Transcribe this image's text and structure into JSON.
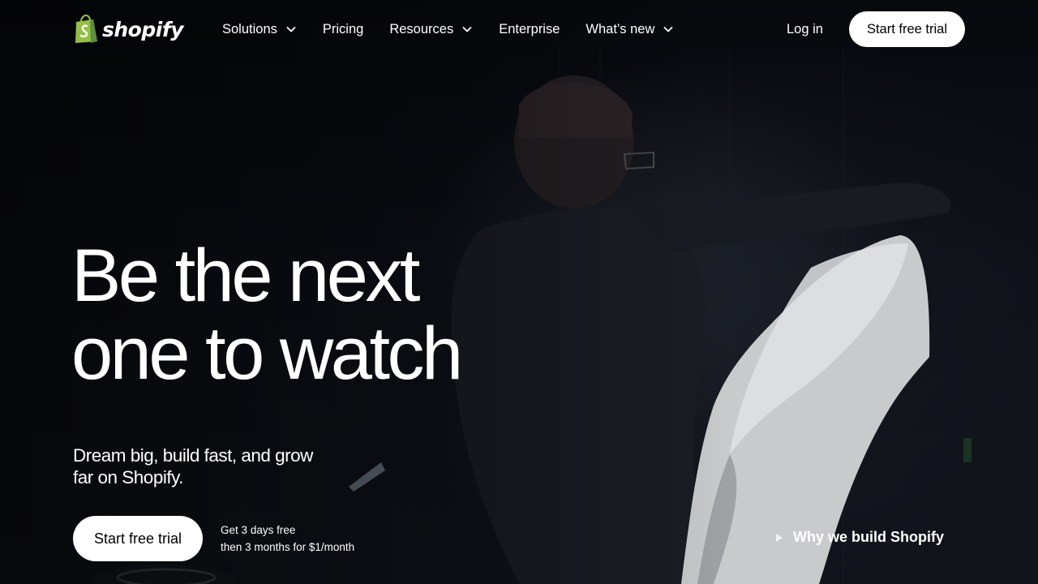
{
  "brand": {
    "name": "shopify",
    "accent": "#95BF47",
    "accent_dark": "#5E8E3E"
  },
  "nav": {
    "items": [
      {
        "label": "Solutions",
        "has_dropdown": true
      },
      {
        "label": "Pricing",
        "has_dropdown": false
      },
      {
        "label": "Resources",
        "has_dropdown": true
      },
      {
        "label": "Enterprise",
        "has_dropdown": false
      },
      {
        "label": "What’s new",
        "has_dropdown": true
      }
    ],
    "login_label": "Log in",
    "cta_label": "Start free trial"
  },
  "hero": {
    "title_line1": "Be the next",
    "title_line2": "one to watch",
    "subtitle": "Dream big, build fast, and grow far on Shopify.",
    "cta_label": "Start free trial",
    "offer_line1": "Get 3 days free",
    "offer_line2": "then 3 months for $1/month",
    "video_link_label": "Why we build Shopify"
  },
  "icons": {
    "logo": "shopping-bag-icon",
    "dropdown": "chevron-down-icon",
    "video": "play-icon"
  },
  "colors": {
    "background": "#0b0d12",
    "text": "#ffffff",
    "button_bg": "#ffffff",
    "button_text": "#000000"
  }
}
